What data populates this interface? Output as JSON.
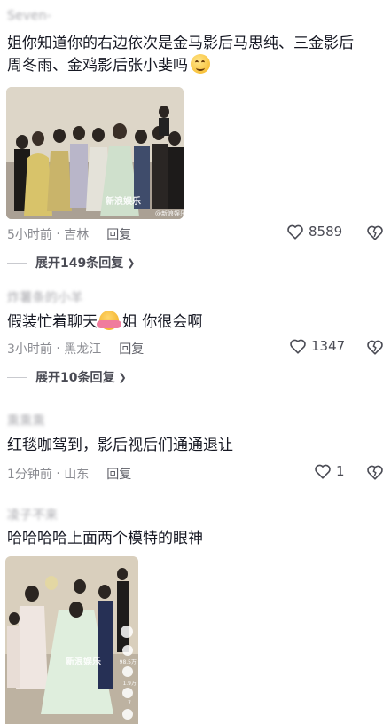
{
  "comments": [
    {
      "username": "Seven-",
      "text": [
        "姐你知道你的右边依次是金马影后马思纯、三金影后",
        "周冬雨、金鸡影后张小斐吗"
      ],
      "time": "5小时前",
      "location": "吉林",
      "reply_label": "回复",
      "likes": "8589",
      "expand_label": "展开149条回复",
      "image_watermark": "新浪娱乐",
      "image_credit": "@新浪娱乐"
    },
    {
      "username": "炸薯条的小羊",
      "text_before": "假装忙着聊天",
      "text_after": "姐 你很会啊",
      "time": "3小时前",
      "location": "黑龙江",
      "reply_label": "回复",
      "likes": "1347",
      "expand_label": "展开10条回复"
    },
    {
      "username": "熏熏熏",
      "text": "红毯咖驾到，影后视后们通通退让",
      "time": "1分钟前",
      "location": "山东",
      "reply_label": "回复",
      "likes": "1"
    },
    {
      "username": "凌子不来",
      "text": "哈哈哈哈上面两个模特的眼神",
      "image_watermark": "新浪娱乐",
      "image_stats": [
        "98.5万",
        "1.9万",
        "7"
      ]
    }
  ],
  "colors": {
    "text": "#161823",
    "meta": "#8a8b91",
    "heart": "#4a4b54"
  },
  "icons": [
    "heart-outline-icon",
    "broken-heart-icon",
    "chevron-down-icon",
    "smile-emoji-icon",
    "hug-emoji-icon"
  ]
}
